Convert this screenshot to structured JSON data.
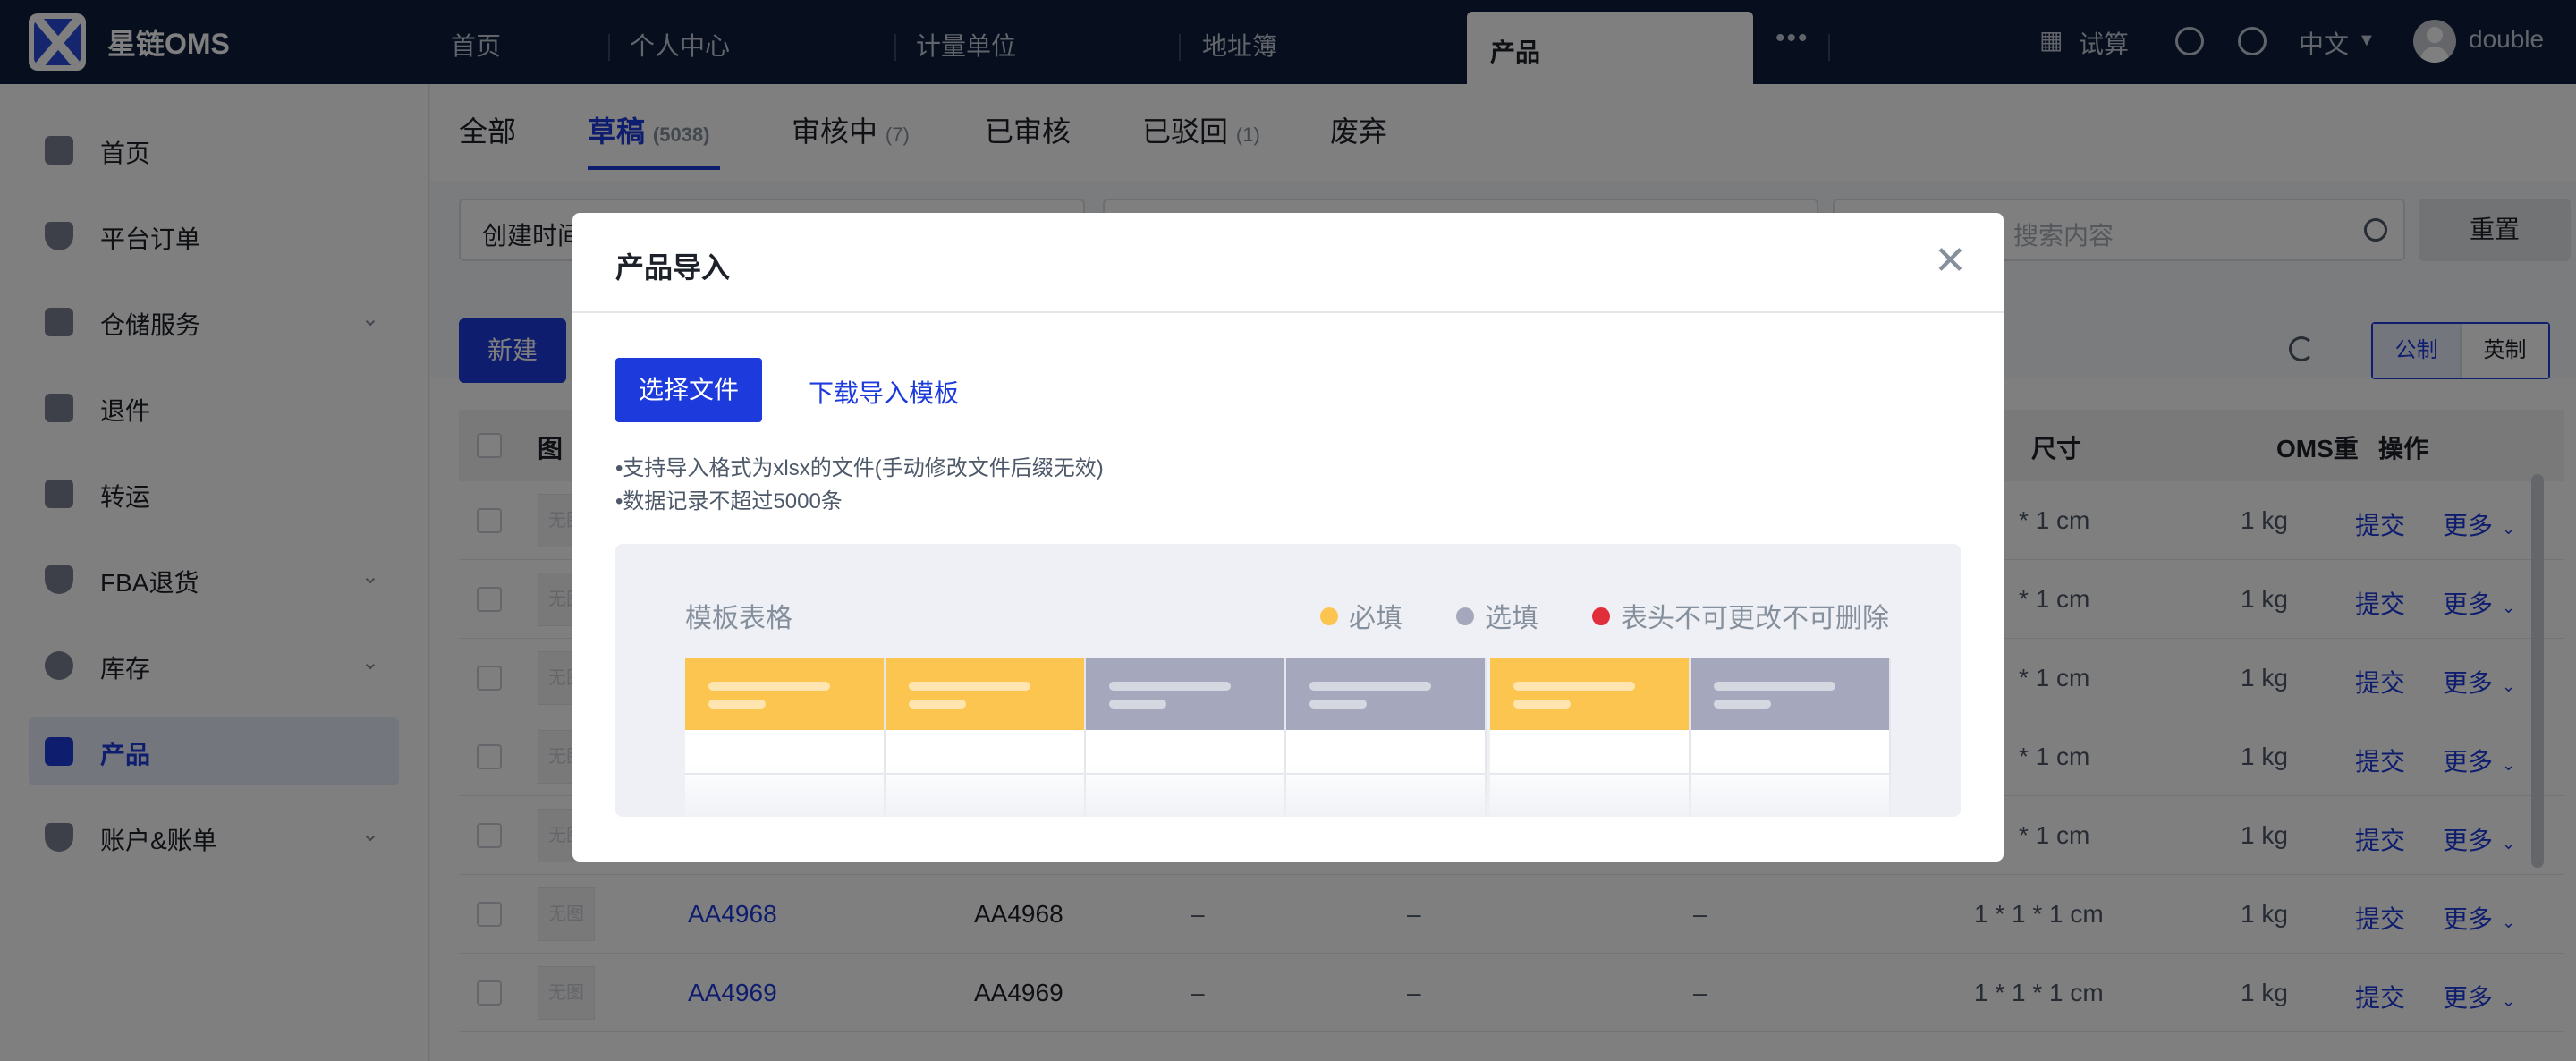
{
  "brand": {
    "name": "星链OMS"
  },
  "topnav": {
    "tabs": [
      "首页",
      "个人中心",
      "计量单位",
      "地址簿"
    ],
    "active_tab": "产品",
    "more": "•••",
    "trial": "试算",
    "language": "中文",
    "user": "double"
  },
  "sidebar": {
    "items": [
      {
        "label": "首页",
        "icon": "home-icon",
        "expandable": false
      },
      {
        "label": "平台订单",
        "icon": "shield-icon",
        "expandable": false
      },
      {
        "label": "仓储服务",
        "icon": "warehouse-icon",
        "expandable": true
      },
      {
        "label": "退件",
        "icon": "truck-icon",
        "expandable": false
      },
      {
        "label": "转运",
        "icon": "truck-icon",
        "expandable": false
      },
      {
        "label": "FBA退货",
        "icon": "shield-icon",
        "expandable": true
      },
      {
        "label": "库存",
        "icon": "pie-icon",
        "expandable": true
      },
      {
        "label": "产品",
        "icon": "bag-icon",
        "expandable": false,
        "active": true
      },
      {
        "label": "账户&账单",
        "icon": "shield-icon",
        "expandable": true
      }
    ]
  },
  "subtabs": [
    {
      "label": "全部",
      "count": ""
    },
    {
      "label": "草稿",
      "count": "(5038)",
      "active": true
    },
    {
      "label": "审核中",
      "count": "(7)"
    },
    {
      "label": "已审核",
      "count": ""
    },
    {
      "label": "已驳回",
      "count": "(1)"
    },
    {
      "label": "废弃",
      "count": ""
    }
  ],
  "filters": {
    "create_time": "创建时间",
    "search_placeholder": "搜索内容",
    "reset": "重置"
  },
  "toolbar": {
    "new": "新建",
    "unit_metric": "公制",
    "unit_imperial": "英制"
  },
  "table": {
    "headers": {
      "image": "图",
      "size": "尺寸",
      "oms": "OMS重",
      "actions": "操作"
    },
    "rows": [
      {
        "sku": "",
        "name": "",
        "c1": "",
        "c2": "",
        "c3": "",
        "size": "* 1 cm",
        "weight": "1 kg"
      },
      {
        "sku": "",
        "name": "",
        "c1": "",
        "c2": "",
        "c3": "",
        "size": "* 1 cm",
        "weight": "1 kg"
      },
      {
        "sku": "",
        "name": "",
        "c1": "",
        "c2": "",
        "c3": "",
        "size": "* 1 cm",
        "weight": "1 kg"
      },
      {
        "sku": "",
        "name": "",
        "c1": "",
        "c2": "",
        "c3": "",
        "size": "* 1 cm",
        "weight": "1 kg"
      },
      {
        "sku": "",
        "name": "",
        "c1": "",
        "c2": "",
        "c3": "",
        "size": "* 1 cm",
        "weight": "1 kg"
      },
      {
        "sku": "AA4968",
        "name": "AA4968",
        "c1": "–",
        "c2": "–",
        "c3": "–",
        "size": "1 * 1 * 1 cm",
        "weight": "1 kg"
      },
      {
        "sku": "AA4969",
        "name": "AA4969",
        "c1": "–",
        "c2": "–",
        "c3": "–",
        "size": "1 * 1 * 1 cm",
        "weight": "1 kg"
      }
    ],
    "no_image": "无图",
    "action_submit": "提交",
    "action_more": "更多"
  },
  "modal": {
    "title": "产品导入",
    "choose_file": "选择文件",
    "download_template": "下载导入模板",
    "note1": "•支持导入格式为xlsx的文件(手动修改文件后缀无效)",
    "note2": "•数据记录不超过5000条",
    "preview": {
      "title": "模板表格",
      "legend_required": "必填",
      "legend_optional": "选填",
      "legend_locked": "表头不可更改不可删除",
      "colors": {
        "required": "#fcc54f",
        "optional": "#a5a8bd",
        "locked": "#e02e3a"
      }
    }
  }
}
